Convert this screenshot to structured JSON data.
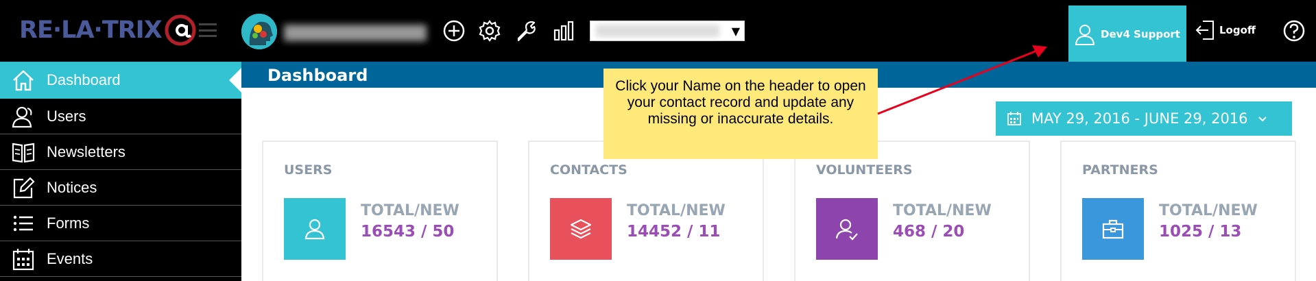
{
  "header": {
    "logo_text": "RE·LA·TRIX",
    "user_label": "Dev4 Support",
    "logoff_label": "Logoff"
  },
  "sidebar": {
    "items": [
      {
        "label": "Dashboard",
        "icon": "home-icon",
        "active": true
      },
      {
        "label": "Users",
        "icon": "users-icon"
      },
      {
        "label": "Newsletters",
        "icon": "newsletter-icon"
      },
      {
        "label": "Notices",
        "icon": "edit-icon"
      },
      {
        "label": "Forms",
        "icon": "list-icon"
      },
      {
        "label": "Events",
        "icon": "calendar-icon"
      }
    ]
  },
  "main": {
    "title": "Dashboard",
    "date_range": "MAY 29, 2016 - JUNE 29, 2016",
    "cards": [
      {
        "title": "USERS",
        "label": "TOTAL/NEW",
        "value": "16543 / 50",
        "color": "#33c3d3",
        "icon": "user-icon"
      },
      {
        "title": "CONTACTS",
        "label": "TOTAL/NEW",
        "value": "14452 / 11",
        "color": "#e8505b",
        "icon": "layers-icon"
      },
      {
        "title": "VOLUNTEERS",
        "label": "TOTAL/NEW",
        "value": "468 / 20",
        "color": "#8e44ad",
        "icon": "user-check-icon"
      },
      {
        "title": "PARTNERS",
        "label": "TOTAL/NEW",
        "value": "1025 / 13",
        "color": "#3a97db",
        "icon": "briefcase-icon"
      }
    ]
  },
  "tooltip": {
    "text": "Click your Name on the header to open your contact record and update any missing or inaccurate details."
  },
  "colors": {
    "accent": "#33c3d3",
    "titlebar": "#006599",
    "value": "#9b4db6",
    "tooltip_bg": "#ffe97a",
    "arrow": "#e8001c"
  }
}
